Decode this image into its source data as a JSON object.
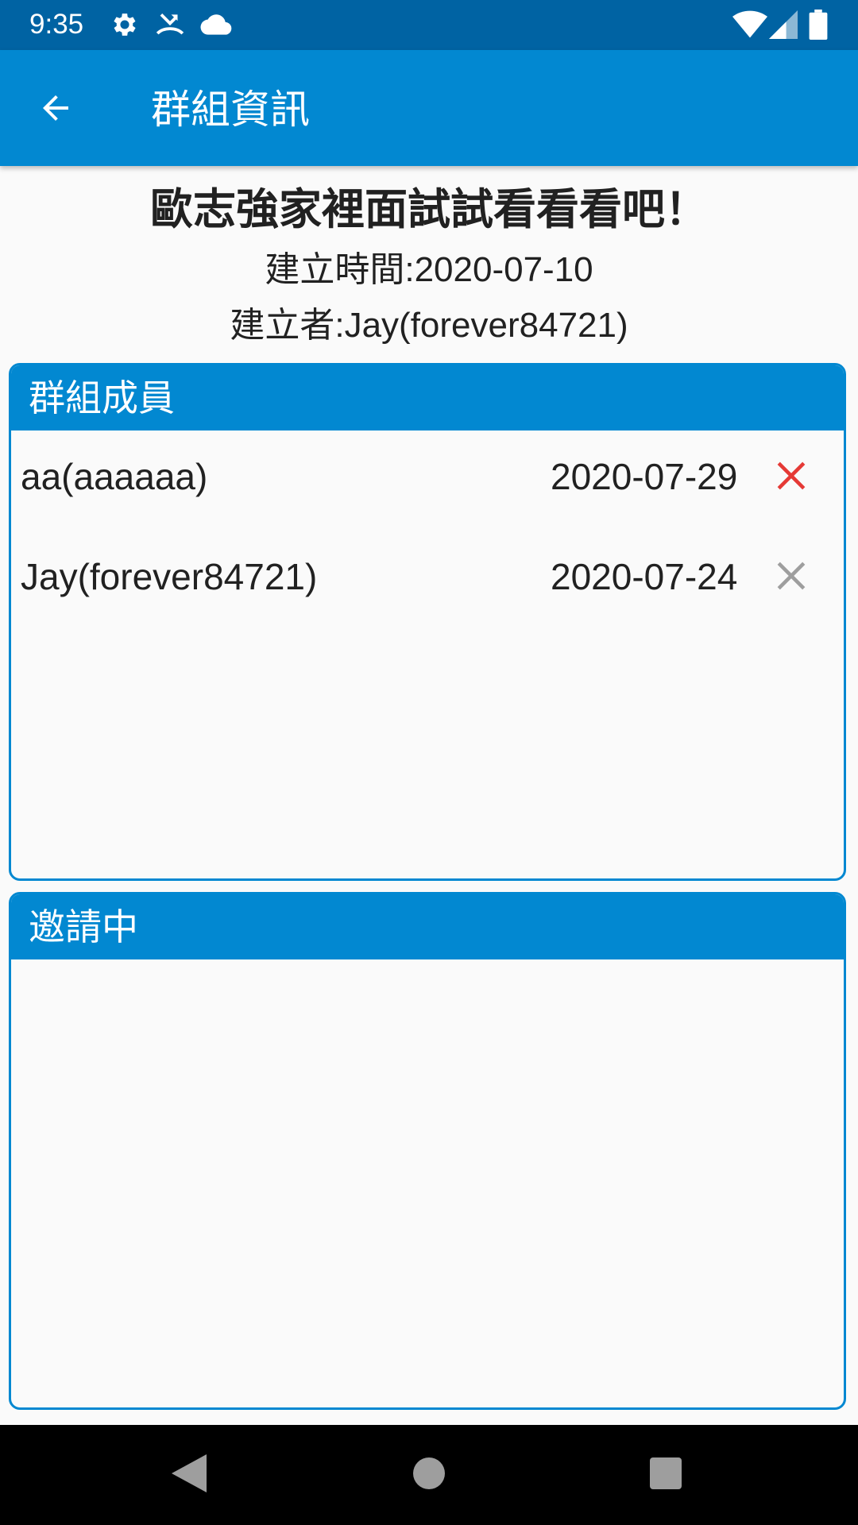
{
  "status_bar": {
    "time": "9:35",
    "icons_left": [
      "settings-icon",
      "call-missed-icon",
      "cloud-icon"
    ],
    "icons_right": [
      "wifi-icon",
      "signal-icon",
      "battery-icon"
    ]
  },
  "app_bar": {
    "back_icon": "arrow-back-icon",
    "title": "群組資訊"
  },
  "group": {
    "name": "歐志強家裡面試試看看看吧！",
    "created_time": "建立時間:2020-07-10",
    "creator": "建立者:Jay(forever84721)"
  },
  "members_panel": {
    "title": "群組成員",
    "members": [
      {
        "name": "aa(aaaaaa)",
        "date": "2020-07-29",
        "remove_icon": "close-icon",
        "remove_color": "#e53935"
      },
      {
        "name": "Jay(forever84721)",
        "date": "2020-07-24",
        "remove_icon": "close-icon",
        "remove_color": "#9e9e9e"
      }
    ]
  },
  "invites_panel": {
    "title": "邀請中",
    "invites": []
  },
  "nav_bar": {
    "icons": [
      "back-triangle-icon",
      "home-circle-icon",
      "recents-square-icon"
    ]
  },
  "colors": {
    "status_bar": "#0063a3",
    "primary": "#0288d1",
    "background": "#fafafa"
  }
}
